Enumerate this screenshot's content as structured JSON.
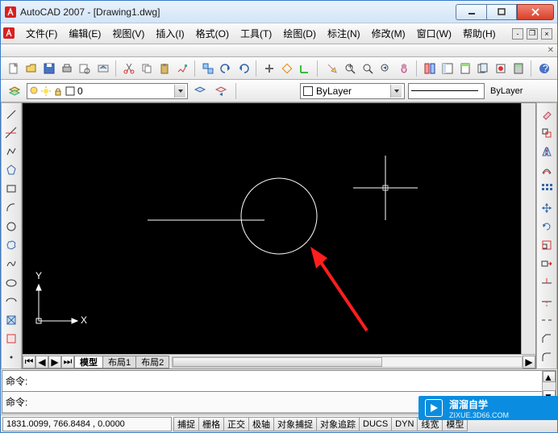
{
  "app": {
    "title": "AutoCAD 2007 - [Drawing1.dwg]"
  },
  "menu": {
    "file": "文件(F)",
    "edit": "编辑(E)",
    "view": "视图(V)",
    "insert": "插入(I)",
    "format": "格式(O)",
    "tools": "工具(T)",
    "draw": "绘图(D)",
    "dimension": "标注(N)",
    "modify": "修改(M)",
    "window": "窗口(W)",
    "help": "帮助(H)"
  },
  "layer": {
    "current": "0",
    "color_dropdown": "ByLayer",
    "linetype_dropdown": "ByLayer"
  },
  "tabs": {
    "model": "模型",
    "layout1": "布局1",
    "layout2": "布局2"
  },
  "command": {
    "prompt1": "命令:",
    "prompt2": "命令:"
  },
  "status": {
    "coords": "1831.0099, 766.8484 , 0.0000",
    "snap": "捕捉",
    "grid": "栅格",
    "ortho": "正交",
    "polar": "极轴",
    "osnap": "对象捕捉",
    "otrack": "对象追踪",
    "ducs": "DUCS",
    "dyn": "DYN",
    "lwt": "线宽",
    "model": "模型"
  },
  "watermark": {
    "brand": "溜溜自学",
    "url": "ZIXUE.3D66.COM"
  },
  "ucs": {
    "x": "X",
    "y": "Y"
  }
}
